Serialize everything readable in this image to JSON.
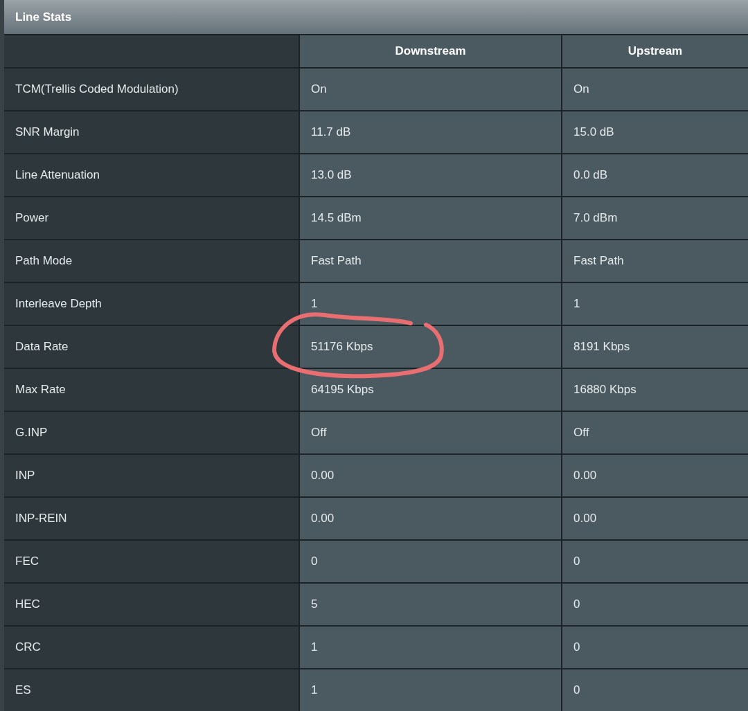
{
  "title": "Line Stats",
  "columns": [
    "",
    "Downstream",
    "Upstream"
  ],
  "rows": [
    {
      "label": "TCM(Trellis Coded Modulation)",
      "downstream": "On",
      "upstream": "On",
      "circled": false
    },
    {
      "label": "SNR Margin",
      "downstream": "11.7 dB",
      "upstream": "15.0 dB",
      "circled": false
    },
    {
      "label": "Line Attenuation",
      "downstream": "13.0 dB",
      "upstream": "0.0 dB",
      "circled": false
    },
    {
      "label": "Power",
      "downstream": "14.5 dBm",
      "upstream": "7.0 dBm",
      "circled": false
    },
    {
      "label": "Path Mode",
      "downstream": "Fast Path",
      "upstream": "Fast Path",
      "circled": false
    },
    {
      "label": "Interleave Depth",
      "downstream": "1",
      "upstream": "1",
      "circled": false
    },
    {
      "label": "Data Rate",
      "downstream": "51176 Kbps",
      "upstream": "8191 Kbps",
      "circled": true
    },
    {
      "label": "Max Rate",
      "downstream": "64195 Kbps",
      "upstream": "16880 Kbps",
      "circled": false
    },
    {
      "label": "G.INP",
      "downstream": "Off",
      "upstream": "Off",
      "circled": false
    },
    {
      "label": "INP",
      "downstream": "0.00",
      "upstream": "0.00",
      "circled": false
    },
    {
      "label": "INP-REIN",
      "downstream": "0.00",
      "upstream": "0.00",
      "circled": false
    },
    {
      "label": "FEC",
      "downstream": "0",
      "upstream": "0",
      "circled": false
    },
    {
      "label": "HEC",
      "downstream": "5",
      "upstream": "0",
      "circled": false
    },
    {
      "label": "CRC",
      "downstream": "1",
      "upstream": "0",
      "circled": false
    },
    {
      "label": "ES",
      "downstream": "1",
      "upstream": "0",
      "circled": false
    }
  ]
}
